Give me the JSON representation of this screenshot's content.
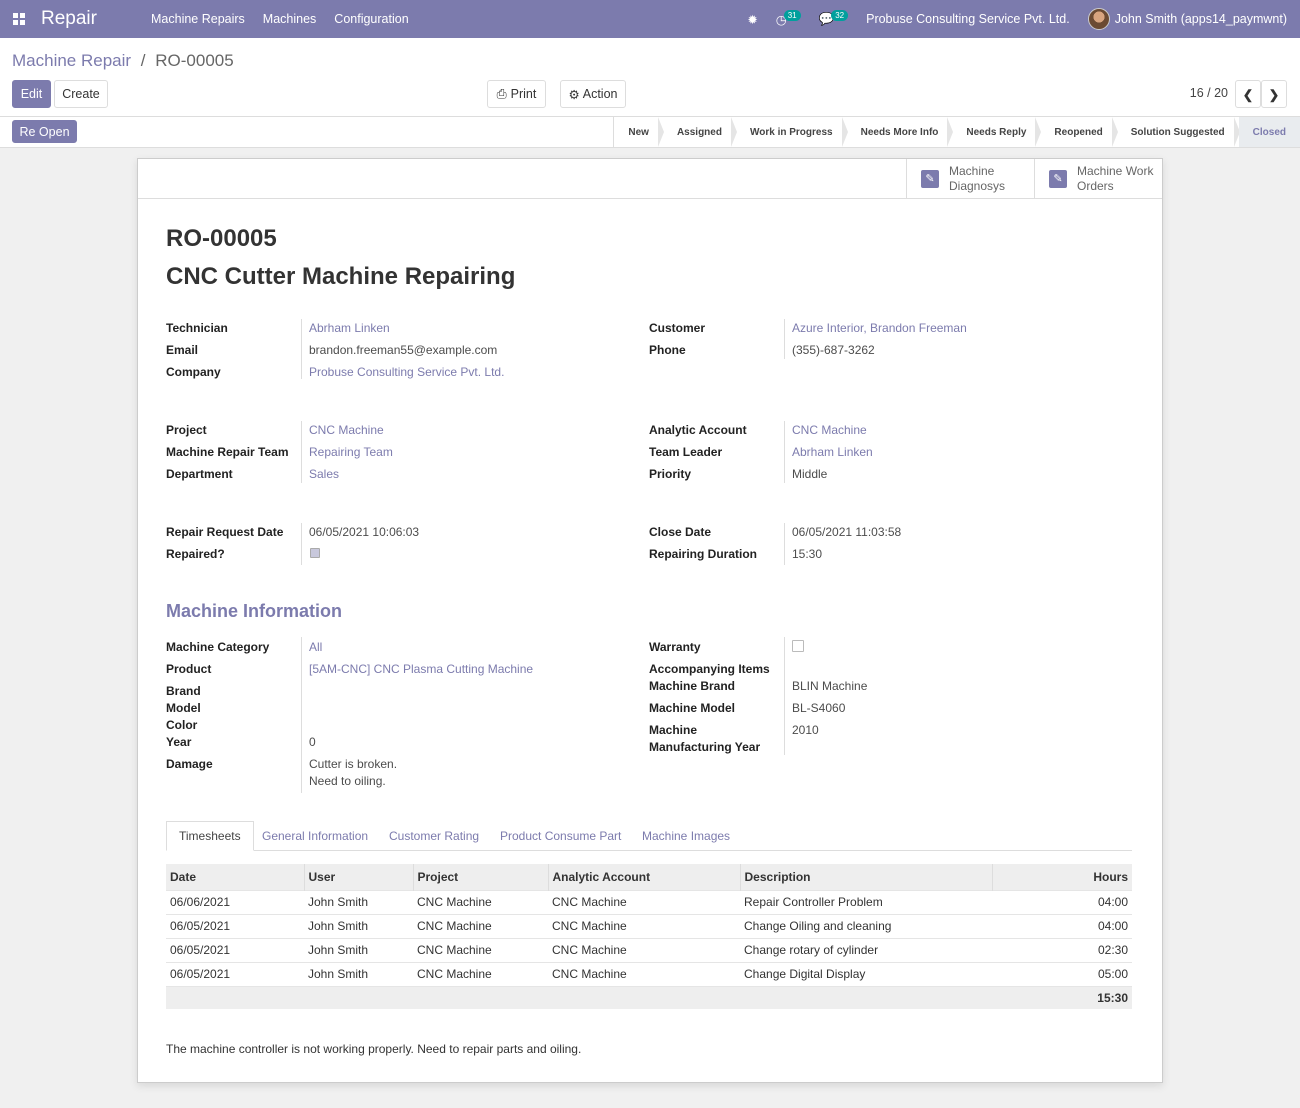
{
  "topnav": {
    "app_name": "Repair",
    "menu": [
      "Machine Repairs",
      "Machines",
      "Configuration"
    ],
    "activity_count": "31",
    "messages_count": "32",
    "company": "Probuse Consulting Service Pvt. Ltd.",
    "user": "John Smith (apps14_paymwnt)",
    "accent": "#7c7bad"
  },
  "breadcrumb": {
    "parent": "Machine Repair",
    "separator": "/",
    "current": "RO-00005"
  },
  "buttons": {
    "edit": "Edit",
    "create": "Create",
    "print": "Print",
    "action": "Action",
    "reopen": "Re Open"
  },
  "pager": {
    "value": "16 / 20"
  },
  "stages": [
    "New",
    "Assigned",
    "Work in Progress",
    "Needs More Info",
    "Needs Reply",
    "Reopened",
    "Solution Suggested",
    "Closed"
  ],
  "active_stage": "Closed",
  "smart_buttons": {
    "diagnosys": [
      "Machine",
      "Diagnosys"
    ],
    "work_orders": [
      "Machine Work",
      "Orders"
    ]
  },
  "record": {
    "number": "RO-00005",
    "name": "CNC Cutter Machine Repairing"
  },
  "labels": {
    "technician": "Technician",
    "email": "Email",
    "company": "Company",
    "customer": "Customer",
    "phone": "Phone",
    "project": "Project",
    "team": "Machine Repair Team",
    "department": "Department",
    "analytic": "Analytic Account",
    "team_leader": "Team Leader",
    "priority": "Priority",
    "request_date": "Repair Request Date",
    "repaired": "Repaired?",
    "close_date": "Close Date",
    "duration": "Repairing Duration",
    "category": "Machine Category",
    "product": "Product",
    "brand": "Brand",
    "model": "Model",
    "color": "Color",
    "year": "Year",
    "damage": "Damage",
    "warranty": "Warranty",
    "accompanying": "Accompanying Items",
    "machine_brand": "Machine Brand",
    "machine_model": "Machine Model",
    "mfg_year_1": "Machine",
    "mfg_year_2": "Manufacturing Year"
  },
  "values": {
    "technician": "Abrham Linken",
    "email": "brandon.freeman55@example.com",
    "company": "Probuse Consulting Service Pvt. Ltd.",
    "customer": "Azure Interior, Brandon Freeman",
    "phone": "(355)-687-3262",
    "project": "CNC Machine",
    "team": "Repairing Team",
    "department": "Sales",
    "analytic": "CNC Machine",
    "team_leader": "Abrham Linken",
    "priority": "Middle",
    "request_date": "06/05/2021 10:06:03",
    "repaired": true,
    "close_date": "06/05/2021 11:03:58",
    "duration": "15:30",
    "category": "All",
    "product": "[5AM-CNC] CNC Plasma Cutting Machine",
    "year": "0",
    "damage_1": "Cutter is broken.",
    "damage_2": "Need to oiling.",
    "warranty": false,
    "machine_brand": "BLIN Machine",
    "machine_model": "BL-S4060",
    "mfg_year": "2010"
  },
  "section_title": "Machine Information",
  "tabs": [
    "Timesheets",
    "General Information",
    "Customer Rating",
    "Product Consume Part",
    "Machine Images"
  ],
  "timesheet": {
    "columns": [
      "Date",
      "User",
      "Project",
      "Analytic Account",
      "Description",
      "Hours"
    ],
    "rows": [
      [
        "06/06/2021",
        "John Smith",
        "CNC Machine",
        "CNC Machine",
        "Repair Controller Problem",
        "04:00"
      ],
      [
        "06/05/2021",
        "John Smith",
        "CNC Machine",
        "CNC Machine",
        "Change Oiling and cleaning",
        "04:00"
      ],
      [
        "06/05/2021",
        "John Smith",
        "CNC Machine",
        "CNC Machine",
        "Change rotary of cylinder",
        "02:30"
      ],
      [
        "06/05/2021",
        "John Smith",
        "CNC Machine",
        "CNC Machine",
        "Change Digital Display",
        "05:00"
      ]
    ],
    "total": "15:30"
  },
  "note": "The machine controller is not working properly. Need to repair parts and oiling."
}
